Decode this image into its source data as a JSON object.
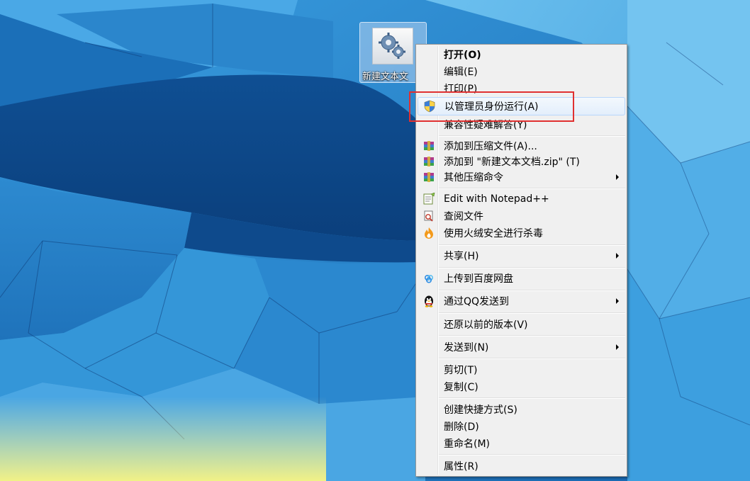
{
  "desktop": {
    "icon": {
      "label": "新建文本文",
      "icon": "gear-document-icon"
    }
  },
  "context_menu": {
    "items": [
      {
        "label": "打开(O)",
        "bold": true,
        "icon": null,
        "submenu": false
      },
      {
        "label": "编辑(E)",
        "icon": null,
        "submenu": false
      },
      {
        "label": "打印(P)",
        "icon": null,
        "submenu": false
      },
      {
        "label": "以管理员身份运行(A)",
        "icon": "uac-shield-icon",
        "submenu": false,
        "hovered": true
      },
      {
        "label": "兼容性疑难解答(Y)",
        "icon": null,
        "submenu": false
      },
      {
        "label": "添加到压缩文件(A)...",
        "icon": "winrar-icon",
        "submenu": false
      },
      {
        "label": "添加到 \"新建文本文档.zip\" (T)",
        "icon": "winrar-icon",
        "submenu": false
      },
      {
        "label": "其他压缩命令",
        "icon": "winrar-icon",
        "submenu": true
      },
      {
        "label": "Edit with Notepad++",
        "icon": "notepad-plus-plus-icon",
        "submenu": false
      },
      {
        "label": "查阅文件",
        "icon": "view-file-icon",
        "submenu": false
      },
      {
        "label": "使用火绒安全进行杀毒",
        "icon": "huorong-flame-icon",
        "submenu": false
      },
      {
        "label": "共享(H)",
        "icon": null,
        "submenu": true
      },
      {
        "label": "上传到百度网盘",
        "icon": "baidu-netdisk-icon",
        "submenu": false
      },
      {
        "label": "通过QQ发送到",
        "icon": "qq-penguin-icon",
        "submenu": true
      },
      {
        "label": "还原以前的版本(V)",
        "icon": null,
        "submenu": false
      },
      {
        "label": "发送到(N)",
        "icon": null,
        "submenu": true
      },
      {
        "label": "剪切(T)",
        "icon": null,
        "submenu": false
      },
      {
        "label": "复制(C)",
        "icon": null,
        "submenu": false
      },
      {
        "label": "创建快捷方式(S)",
        "icon": null,
        "submenu": false
      },
      {
        "label": "删除(D)",
        "icon": null,
        "submenu": false
      },
      {
        "label": "重命名(M)",
        "icon": null,
        "submenu": false
      },
      {
        "label": "属性(R)",
        "icon": null,
        "submenu": false
      }
    ]
  },
  "colors": {
    "highlight_box": "#e03030",
    "menu_background": "#f0f0f0",
    "hover_border": "#b8d6fb"
  }
}
